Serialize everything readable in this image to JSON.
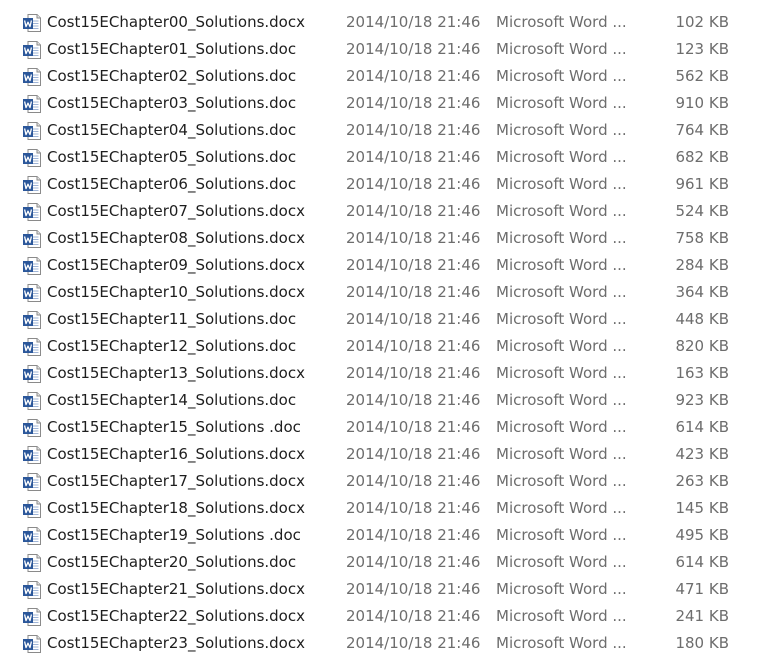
{
  "files": [
    {
      "name": "Cost15EChapter00_Solutions.docx",
      "modified": "2014/10/18 21:46",
      "type": "Microsoft Word ...",
      "size": "102 KB",
      "icon": "word-document-icon"
    },
    {
      "name": "Cost15EChapter01_Solutions.doc",
      "modified": "2014/10/18 21:46",
      "type": "Microsoft Word ...",
      "size": "123 KB",
      "icon": "word-document-icon"
    },
    {
      "name": "Cost15EChapter02_Solutions.doc",
      "modified": "2014/10/18 21:46",
      "type": "Microsoft Word ...",
      "size": "562 KB",
      "icon": "word-document-icon"
    },
    {
      "name": "Cost15EChapter03_Solutions.doc",
      "modified": "2014/10/18 21:46",
      "type": "Microsoft Word ...",
      "size": "910 KB",
      "icon": "word-document-icon"
    },
    {
      "name": "Cost15EChapter04_Solutions.doc",
      "modified": "2014/10/18 21:46",
      "type": "Microsoft Word ...",
      "size": "764 KB",
      "icon": "word-document-icon"
    },
    {
      "name": "Cost15EChapter05_Solutions.doc",
      "modified": "2014/10/18 21:46",
      "type": "Microsoft Word ...",
      "size": "682 KB",
      "icon": "word-document-icon"
    },
    {
      "name": "Cost15EChapter06_Solutions.doc",
      "modified": "2014/10/18 21:46",
      "type": "Microsoft Word ...",
      "size": "961 KB",
      "icon": "word-document-icon"
    },
    {
      "name": "Cost15EChapter07_Solutions.docx",
      "modified": "2014/10/18 21:46",
      "type": "Microsoft Word ...",
      "size": "524 KB",
      "icon": "word-document-icon"
    },
    {
      "name": "Cost15EChapter08_Solutions.docx",
      "modified": "2014/10/18 21:46",
      "type": "Microsoft Word ...",
      "size": "758 KB",
      "icon": "word-document-icon"
    },
    {
      "name": "Cost15EChapter09_Solutions.docx",
      "modified": "2014/10/18 21:46",
      "type": "Microsoft Word ...",
      "size": "284 KB",
      "icon": "word-document-icon"
    },
    {
      "name": "Cost15EChapter10_Solutions.docx",
      "modified": "2014/10/18 21:46",
      "type": "Microsoft Word ...",
      "size": "364 KB",
      "icon": "word-document-icon"
    },
    {
      "name": "Cost15EChapter11_Solutions.doc",
      "modified": "2014/10/18 21:46",
      "type": "Microsoft Word ...",
      "size": "448 KB",
      "icon": "word-document-icon"
    },
    {
      "name": "Cost15EChapter12_Solutions.doc",
      "modified": "2014/10/18 21:46",
      "type": "Microsoft Word ...",
      "size": "820 KB",
      "icon": "word-document-icon"
    },
    {
      "name": "Cost15EChapter13_Solutions.docx",
      "modified": "2014/10/18 21:46",
      "type": "Microsoft Word ...",
      "size": "163 KB",
      "icon": "word-document-icon"
    },
    {
      "name": "Cost15EChapter14_Solutions.doc",
      "modified": "2014/10/18 21:46",
      "type": "Microsoft Word ...",
      "size": "923 KB",
      "icon": "word-document-icon"
    },
    {
      "name": "Cost15EChapter15_Solutions .doc",
      "modified": "2014/10/18 21:46",
      "type": "Microsoft Word ...",
      "size": "614 KB",
      "icon": "word-document-icon"
    },
    {
      "name": "Cost15EChapter16_Solutions.docx",
      "modified": "2014/10/18 21:46",
      "type": "Microsoft Word ...",
      "size": "423 KB",
      "icon": "word-document-icon"
    },
    {
      "name": "Cost15EChapter17_Solutions.docx",
      "modified": "2014/10/18 21:46",
      "type": "Microsoft Word ...",
      "size": "263 KB",
      "icon": "word-document-icon"
    },
    {
      "name": "Cost15EChapter18_Solutions.docx",
      "modified": "2014/10/18 21:46",
      "type": "Microsoft Word ...",
      "size": "145 KB",
      "icon": "word-document-icon"
    },
    {
      "name": "Cost15EChapter19_Solutions .doc",
      "modified": "2014/10/18 21:46",
      "type": "Microsoft Word ...",
      "size": "495 KB",
      "icon": "word-document-icon"
    },
    {
      "name": "Cost15EChapter20_Solutions.doc",
      "modified": "2014/10/18 21:46",
      "type": "Microsoft Word ...",
      "size": "614 KB",
      "icon": "word-document-icon"
    },
    {
      "name": "Cost15EChapter21_Solutions.docx",
      "modified": "2014/10/18 21:46",
      "type": "Microsoft Word ...",
      "size": "471 KB",
      "icon": "word-document-icon"
    },
    {
      "name": "Cost15EChapter22_Solutions.docx",
      "modified": "2014/10/18 21:46",
      "type": "Microsoft Word ...",
      "size": "241 KB",
      "icon": "word-document-icon"
    },
    {
      "name": "Cost15EChapter23_Solutions.docx",
      "modified": "2014/10/18 21:46",
      "type": "Microsoft Word ...",
      "size": "180 KB",
      "icon": "word-document-icon"
    }
  ],
  "colors": {
    "name_text": "#1e1e1e",
    "detail_text": "#6d6d6d",
    "word_blue": "#2b579a",
    "background": "#ffffff"
  }
}
